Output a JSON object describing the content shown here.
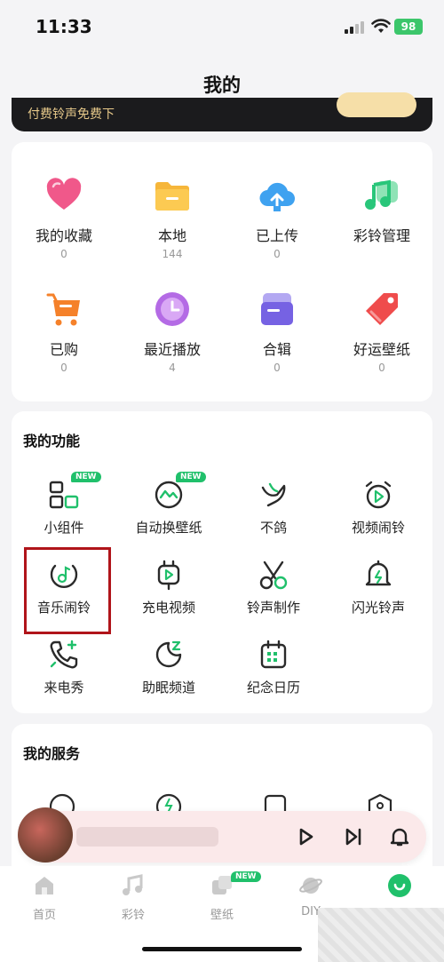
{
  "status": {
    "time": "11:33",
    "battery": "98"
  },
  "header": {
    "title": "我的"
  },
  "banner": {
    "text": "付费铃声免费下"
  },
  "stats": [
    {
      "label": "我的收藏",
      "count": "0",
      "icon": "heart-icon",
      "color": "#f0588a"
    },
    {
      "label": "本地",
      "count": "144",
      "icon": "folder-icon",
      "color": "#f6b63a"
    },
    {
      "label": "已上传",
      "count": "0",
      "icon": "cloud-upload-icon",
      "color": "#3fa2f0"
    },
    {
      "label": "彩铃管理",
      "count": "",
      "icon": "music-manage-icon",
      "color": "#29c67a"
    },
    {
      "label": "已购",
      "count": "0",
      "icon": "cart-icon",
      "color": "#f5812a"
    },
    {
      "label": "最近播放",
      "count": "4",
      "icon": "clock-icon",
      "color": "#b46be5"
    },
    {
      "label": "合辑",
      "count": "0",
      "icon": "album-icon",
      "color": "#7662e3"
    },
    {
      "label": "好运壁纸",
      "count": "0",
      "icon": "tag-icon",
      "color": "#ef4c4c"
    }
  ],
  "functions": {
    "title": "我的功能",
    "items": [
      {
        "label": "小组件",
        "icon": "widget-icon",
        "badge": "NEW"
      },
      {
        "label": "自动换壁纸",
        "icon": "auto-wallpaper-icon",
        "badge": "NEW"
      },
      {
        "label": "不鸽",
        "icon": "dove-icon",
        "badge": ""
      },
      {
        "label": "视频闹铃",
        "icon": "video-alarm-icon",
        "badge": ""
      },
      {
        "label": "音乐闹铃",
        "icon": "music-alarm-icon",
        "badge": ""
      },
      {
        "label": "充电视频",
        "icon": "charge-video-icon",
        "badge": ""
      },
      {
        "label": "铃声制作",
        "icon": "scissors-icon",
        "badge": ""
      },
      {
        "label": "闪光铃声",
        "icon": "flash-bell-icon",
        "badge": ""
      },
      {
        "label": "来电秀",
        "icon": "phone-show-icon",
        "badge": ""
      },
      {
        "label": "助眠频道",
        "icon": "sleep-icon",
        "badge": ""
      },
      {
        "label": "纪念日历",
        "icon": "calendar-icon",
        "badge": ""
      }
    ]
  },
  "services": {
    "title": "我的服务"
  },
  "tabs": [
    {
      "label": "首页",
      "icon": "home-icon"
    },
    {
      "label": "彩铃",
      "icon": "music-note-icon"
    },
    {
      "label": "壁纸",
      "icon": "wallpaper-icon",
      "badge": "NEW"
    },
    {
      "label": "DIY",
      "icon": "planet-icon"
    },
    {
      "label": "",
      "icon": "profile-icon"
    }
  ],
  "colors": {
    "accent": "#20c06b",
    "highlight": "#b0141a",
    "icon_dark": "#2a2a2a",
    "icon_accent": "#20c06b"
  }
}
